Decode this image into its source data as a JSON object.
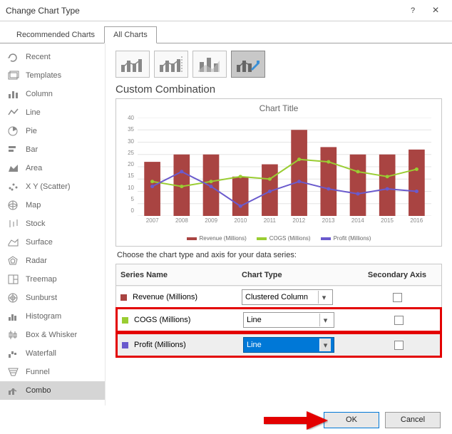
{
  "window": {
    "title": "Change Chart Type",
    "help_label": "?",
    "close_label": "×"
  },
  "tabs": {
    "recommended": "Recommended Charts",
    "all": "All Charts"
  },
  "sidebar": {
    "items": [
      {
        "label": "Recent"
      },
      {
        "label": "Templates"
      },
      {
        "label": "Column"
      },
      {
        "label": "Line"
      },
      {
        "label": "Pie"
      },
      {
        "label": "Bar"
      },
      {
        "label": "Area"
      },
      {
        "label": "X Y (Scatter)"
      },
      {
        "label": "Map"
      },
      {
        "label": "Stock"
      },
      {
        "label": "Surface"
      },
      {
        "label": "Radar"
      },
      {
        "label": "Treemap"
      },
      {
        "label": "Sunburst"
      },
      {
        "label": "Histogram"
      },
      {
        "label": "Box & Whisker"
      },
      {
        "label": "Waterfall"
      },
      {
        "label": "Funnel"
      },
      {
        "label": "Combo"
      }
    ]
  },
  "section_title": "Custom Combination",
  "preview_title": "Chart Title",
  "chart_data": {
    "type": "combo",
    "categories": [
      "2007",
      "2008",
      "2009",
      "2010",
      "2011",
      "2012",
      "2013",
      "2014",
      "2015",
      "2016"
    ],
    "series": [
      {
        "name": "Revenue (Millions)",
        "type": "bar",
        "color": "#a94442",
        "values": [
          22,
          25,
          25,
          16,
          21,
          35,
          28,
          25,
          25,
          27
        ]
      },
      {
        "name": "COGS (Millions)",
        "type": "line",
        "color": "#9acd32",
        "values": [
          14,
          12,
          14,
          16,
          15,
          23,
          22,
          18,
          16,
          19
        ]
      },
      {
        "name": "Profit (Millions)",
        "type": "line",
        "color": "#6a5acd",
        "values": [
          12,
          18,
          12,
          4,
          10,
          14,
          11,
          9,
          11,
          10
        ]
      }
    ],
    "ylim": [
      0,
      40
    ],
    "ytick_step": 5
  },
  "series_block": {
    "instruction": "Choose the chart type and axis for your data series:",
    "headers": {
      "name": "Series Name",
      "type": "Chart Type",
      "secondary": "Secondary Axis"
    },
    "rows": [
      {
        "swatch": "#a94442",
        "name": "Revenue (Millions)",
        "chart_type": "Clustered Column",
        "secondary": false,
        "highlighted": false,
        "combo_selected": false
      },
      {
        "swatch": "#9acd32",
        "name": "COGS (Millions)",
        "chart_type": "Line",
        "secondary": false,
        "highlighted": true,
        "combo_selected": false
      },
      {
        "swatch": "#6a5acd",
        "name": "Profit (Millions)",
        "chart_type": "Line",
        "secondary": false,
        "highlighted": true,
        "combo_selected": true
      }
    ]
  },
  "footer": {
    "ok": "OK",
    "cancel": "Cancel"
  }
}
